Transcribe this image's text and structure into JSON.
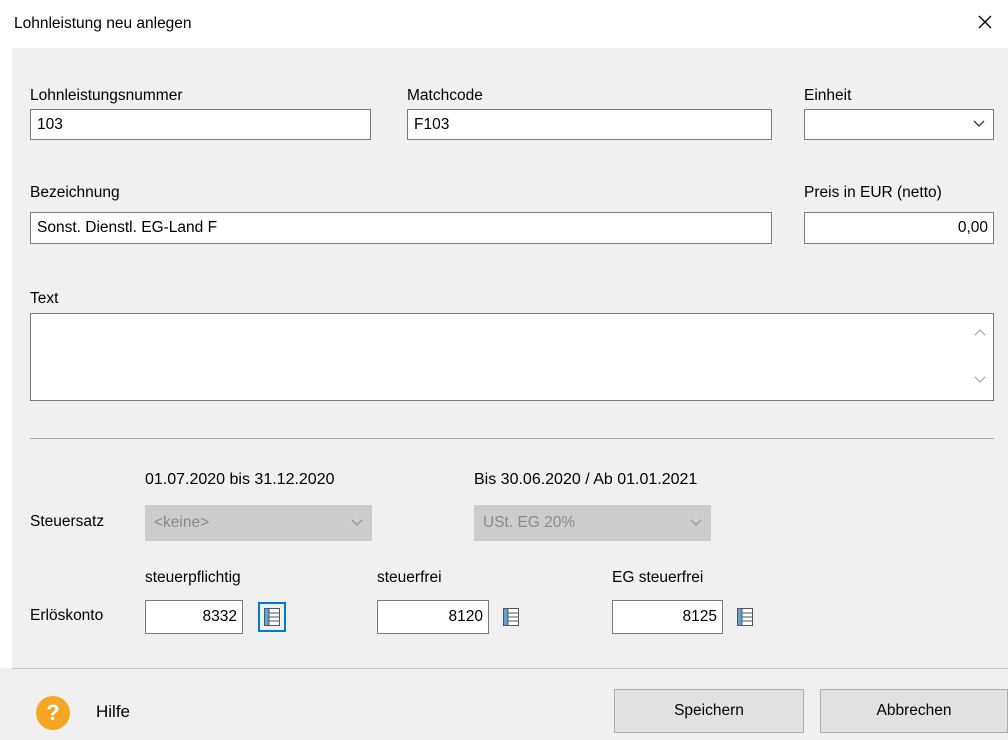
{
  "window": {
    "title": "Lohnleistung neu anlegen",
    "close_icon": "close-icon"
  },
  "fields": {
    "lohnleistungsnummer": {
      "label": "Lohnleistungsnummer",
      "value": "103"
    },
    "matchcode": {
      "label": "Matchcode",
      "value": "F103"
    },
    "einheit": {
      "label": "Einheit",
      "value": ""
    },
    "bezeichnung": {
      "label": "Bezeichnung",
      "value": "Sonst. Dienstl. EG-Land F"
    },
    "preis": {
      "label": "Preis in EUR (netto)",
      "value": "0,00"
    },
    "text": {
      "label": "Text",
      "value": ""
    }
  },
  "tax": {
    "label": "Steuersatz",
    "period1_label": "01.07.2020 bis 31.12.2020",
    "period1_value": "<keine>",
    "period2_label": "Bis 30.06.2020 / Ab 01.01.2021",
    "period2_value": "USt. EG 20%"
  },
  "revenue": {
    "label": "Erlöskonto",
    "taxable_label": "steuerpflichtig",
    "taxable_value": "8332",
    "taxfree_label": "steuerfrei",
    "taxfree_value": "8120",
    "eu_taxfree_label": "EG steuerfrei",
    "eu_taxfree_value": "8125"
  },
  "footer": {
    "help_label": "Hilfe",
    "help_icon_glyph": "?",
    "save_label": "Speichern",
    "cancel_label": "Abbrechen"
  },
  "colors": {
    "accent": "#0078d7",
    "help_icon": "#f5a623",
    "dialog_bg": "#f0f0f0"
  }
}
